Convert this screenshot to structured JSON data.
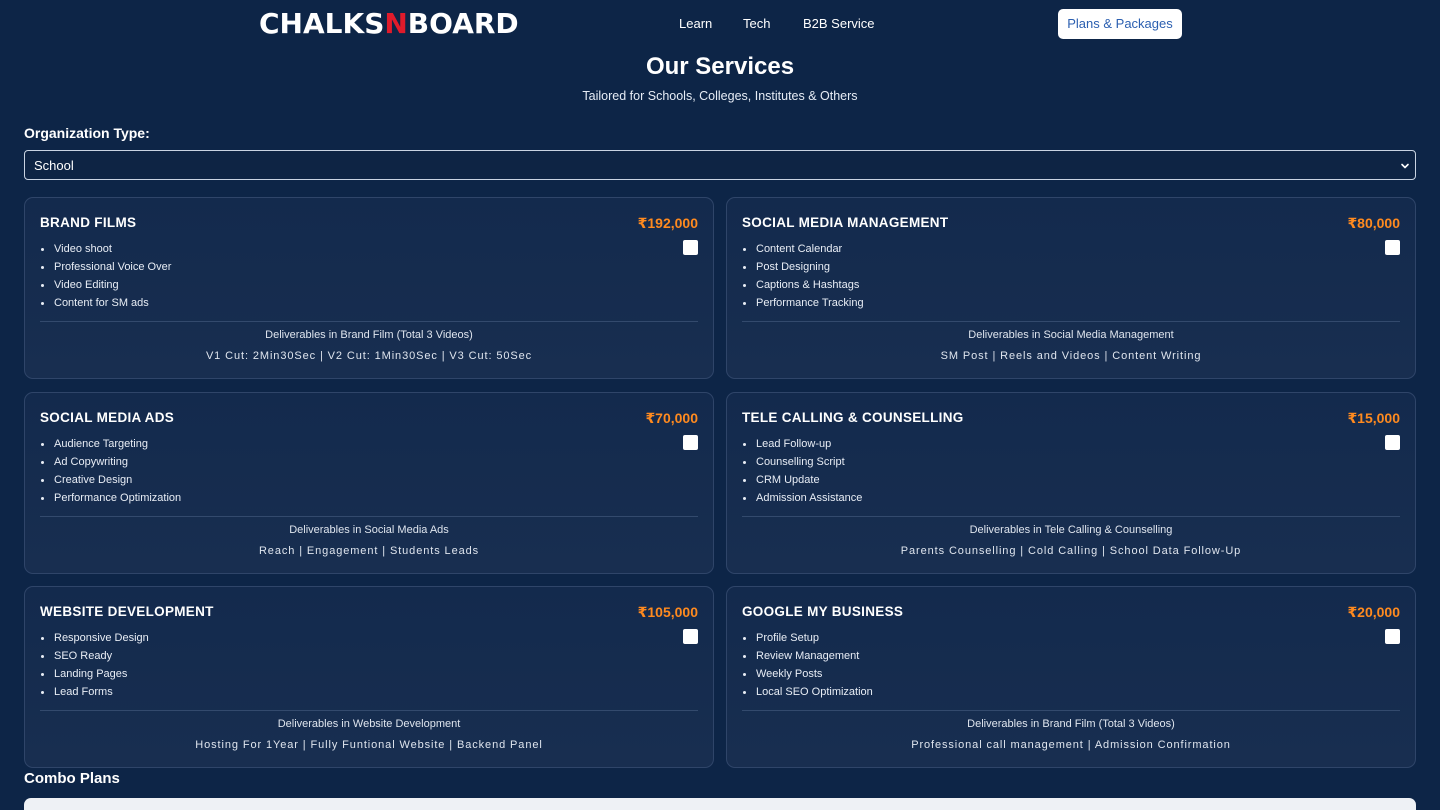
{
  "header": {
    "logo_part1": "CHALKS",
    "logo_part2": "N",
    "logo_part3": "BOARD",
    "nav": [
      "Learn",
      "Tech",
      "B2B Service"
    ],
    "plans_button": "Plans & Packages"
  },
  "page": {
    "title": "Our Services",
    "subtitle": "Tailored for Schools, Colleges, Institutes & Others"
  },
  "org": {
    "label": "Organization Type:",
    "selected": "School"
  },
  "services": [
    {
      "title": "BRAND FILMS",
      "price": "₹192,000",
      "features": [
        "Video shoot",
        "Professional Voice Over",
        "Video Editing",
        "Content for SM ads"
      ],
      "deliverables_title": "Deliverables in Brand Film (Total 3 Videos)",
      "deliverables": "V1 Cut: 2Min30Sec | V2 Cut: 1Min30Sec | V3 Cut: 50Sec",
      "checked": false
    },
    {
      "title": "SOCIAL MEDIA MANAGEMENT",
      "price": "₹80,000",
      "features": [
        "Content Calendar",
        "Post Designing",
        "Captions & Hashtags",
        "Performance Tracking"
      ],
      "deliverables_title": "Deliverables in Social Media Management",
      "deliverables": "SM Post | Reels and Videos | Content Writing",
      "checked": false
    },
    {
      "title": "SOCIAL MEDIA ADS",
      "price": "₹70,000",
      "features": [
        "Audience Targeting",
        "Ad Copywriting",
        "Creative Design",
        "Performance Optimization"
      ],
      "deliverables_title": "Deliverables in Social Media Ads",
      "deliverables": "Reach | Engagement | Students Leads",
      "checked": false
    },
    {
      "title": "TELE CALLING & COUNSELLING",
      "price": "₹15,000",
      "features": [
        "Lead Follow-up",
        "Counselling Script",
        "CRM Update",
        "Admission Assistance"
      ],
      "deliverables_title": "Deliverables in Tele Calling & Counselling",
      "deliverables": "Parents Counselling | Cold Calling | School Data Follow-Up",
      "checked": false
    },
    {
      "title": "WEBSITE DEVELOPMENT",
      "price": "₹105,000",
      "features": [
        "Responsive Design",
        "SEO Ready",
        "Landing Pages",
        "Lead Forms"
      ],
      "deliverables_title": "Deliverables in Website Development",
      "deliverables": "Hosting For 1Year | Fully Funtional Website | Backend Panel",
      "checked": false
    },
    {
      "title": "GOOGLE MY BUSINESS",
      "price": "₹20,000",
      "features": [
        "Profile Setup",
        "Review Management",
        "Weekly Posts",
        "Local SEO Optimization"
      ],
      "deliverables_title": "Deliverables in Brand Film (Total 3 Videos)",
      "deliverables": "Professional call management | Admission Confirmation",
      "checked": false
    }
  ],
  "combo": {
    "title": "Combo Plans"
  },
  "colors": {
    "background": "#0d2547",
    "price_accent": "#ff8a1f",
    "logo_accent": "#e01b2b",
    "button_text": "#2b5fb0"
  }
}
